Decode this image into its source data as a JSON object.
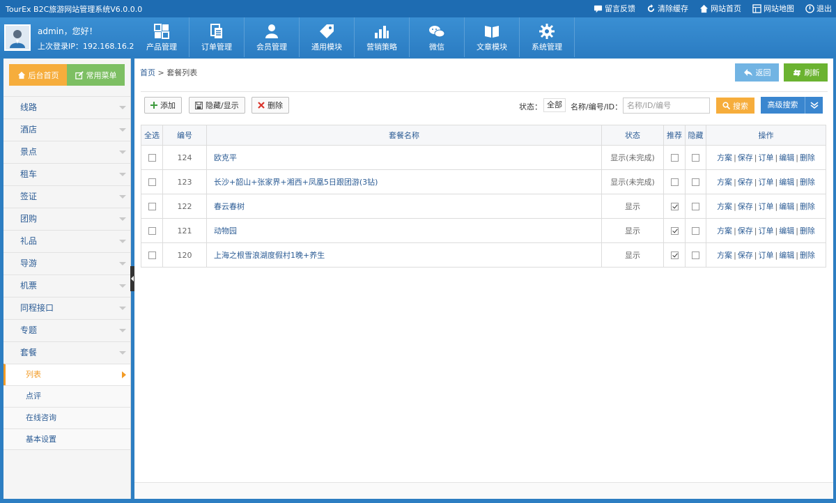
{
  "app": {
    "title": "TourEx B2C旅游网站管理系统V6.0.0.0",
    "top_links": [
      {
        "label": "留言反馈",
        "icon": "feedback-icon"
      },
      {
        "label": "清除缓存",
        "icon": "refresh-cache-icon"
      },
      {
        "label": "网站首页",
        "icon": "home-icon"
      },
      {
        "label": "网站地图",
        "icon": "sitemap-icon"
      },
      {
        "label": "退出",
        "icon": "power-icon"
      }
    ]
  },
  "user": {
    "greeting": "admin，您好！",
    "last_login": "上次登录IP：192.168.16.2"
  },
  "nav": [
    {
      "label": "产品管理",
      "icon": "grid-icon"
    },
    {
      "label": "订单管理",
      "icon": "orders-icon"
    },
    {
      "label": "会员管理",
      "icon": "member-icon"
    },
    {
      "label": "通用模块",
      "icon": "tag-icon"
    },
    {
      "label": "营销策略",
      "icon": "bar-chart-icon"
    },
    {
      "label": "微信",
      "icon": "wechat-icon"
    },
    {
      "label": "文章模块",
      "icon": "book-icon"
    },
    {
      "label": "系统管理",
      "icon": "gear-icon"
    }
  ],
  "sidebar": {
    "home_label": "后台首页",
    "common_label": "常用菜单",
    "items": [
      "线路",
      "酒店",
      "景点",
      "租车",
      "签证",
      "团购",
      "礼品",
      "导游",
      "机票",
      "同程接口",
      "专题",
      "套餐"
    ],
    "sub_items": [
      "列表",
      "点评",
      "在线咨询",
      "基本设置"
    ],
    "active_sub": "列表"
  },
  "breadcrumb": {
    "home": "首页",
    "separator": ">",
    "current": "套餐列表"
  },
  "actions": {
    "back": "返回",
    "refresh": "刷新"
  },
  "toolbar": {
    "add": "添加",
    "toggle": "隐藏/显示",
    "delete": "删除",
    "status_label": "状态：",
    "status_value": "全部",
    "search_label": "名称/编号/ID：",
    "search_placeholder": "名称/ID/编号",
    "search_button": "搜索",
    "advanced_button": "高级搜索"
  },
  "table": {
    "headers": [
      "全选",
      "编号",
      "套餐名称",
      "状态",
      "推荐",
      "隐藏",
      "操作"
    ],
    "ops": [
      "方案",
      "保存",
      "订单",
      "编辑",
      "删除"
    ],
    "rows": [
      {
        "id": "124",
        "name": "欧克平",
        "status": "显示(未完成)",
        "recommend": false,
        "hidden": false
      },
      {
        "id": "123",
        "name": "长沙+韶山+张家界+湘西+凤凰5日跟团游(3钻)",
        "status": "显示(未完成)",
        "recommend": false,
        "hidden": false
      },
      {
        "id": "122",
        "name": "春云春树",
        "status": "显示",
        "recommend": true,
        "hidden": false
      },
      {
        "id": "121",
        "name": "动物园",
        "status": "显示",
        "recommend": true,
        "hidden": false
      },
      {
        "id": "120",
        "name": "上海之根雪浪湖度假村1晚+养生",
        "status": "显示",
        "recommend": true,
        "hidden": false
      }
    ]
  },
  "colors": {
    "topbar": "#1e6cb2",
    "header": "#2b7cc2",
    "orange": "#f6ad3c",
    "green": "#7dbf63",
    "link": "#2c5c95"
  }
}
